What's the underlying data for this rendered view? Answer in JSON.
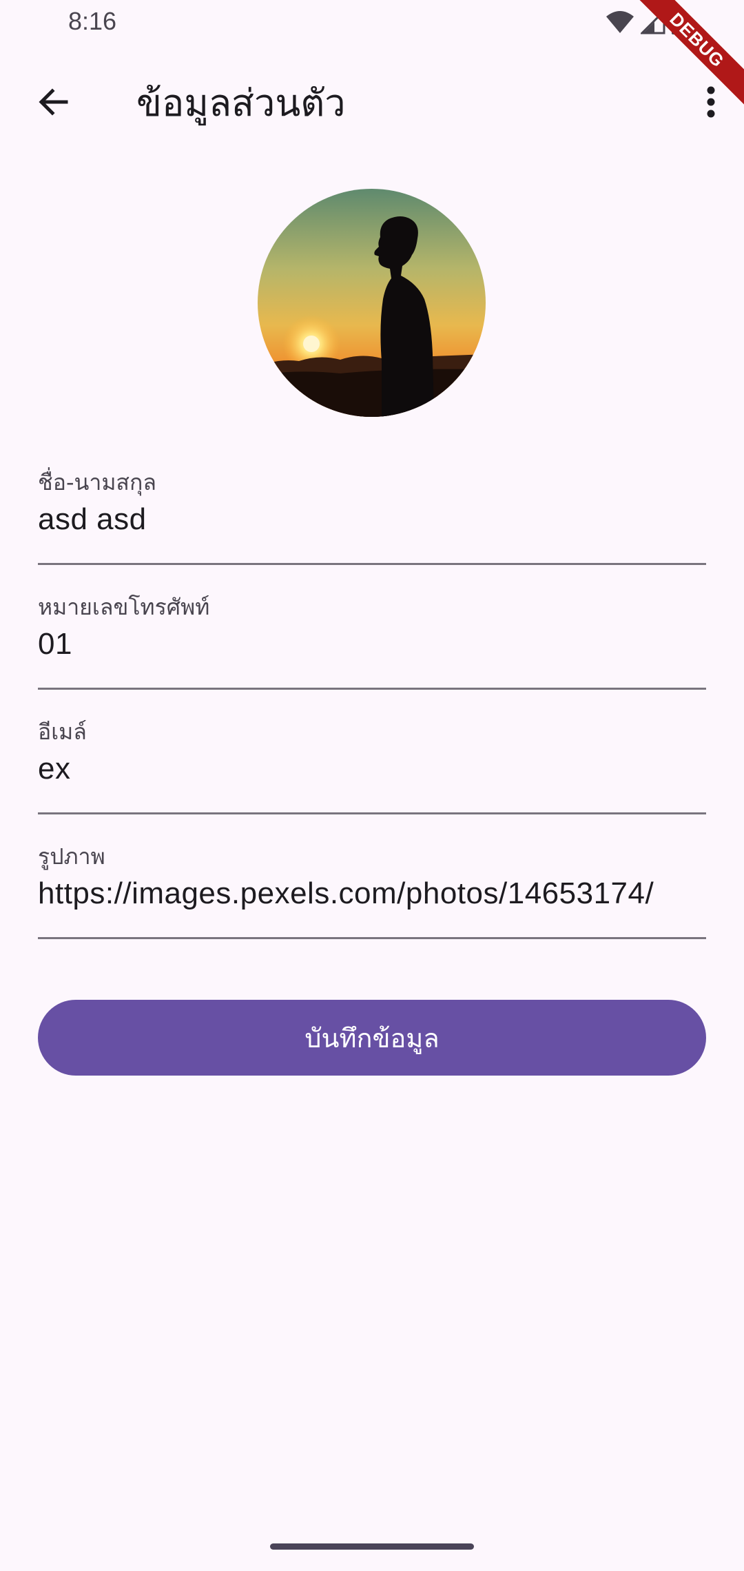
{
  "status_bar": {
    "time": "8:16",
    "icons": [
      "wifi-icon",
      "signal-icon",
      "battery-icon"
    ]
  },
  "debug_banner": {
    "label": "DEBUG"
  },
  "app_bar": {
    "back_icon": "arrow-back-icon",
    "title": "ข้อมูลส่วนตัว",
    "more_icon": "more-vert-icon"
  },
  "profile": {
    "avatar_icon": "avatar-sunset-silhouette"
  },
  "form": {
    "fields": [
      {
        "label": "ชื่อ-นามสกุล",
        "value": "asd asd"
      },
      {
        "label": "หมายเลขโทรศัพท์",
        "value": "01"
      },
      {
        "label": "อีเมล์",
        "value": "ex"
      },
      {
        "label": "รูปภาพ",
        "value": "https://images.pexels.com/photos/14653174/"
      }
    ]
  },
  "actions": {
    "save_label": "บันทึกข้อมูล"
  },
  "colors": {
    "background": "#fdf7fd",
    "primary": "#6750a4",
    "text": "#1d1b20",
    "label": "#49454f",
    "underline": "#79747e",
    "debug": "#b01818"
  }
}
